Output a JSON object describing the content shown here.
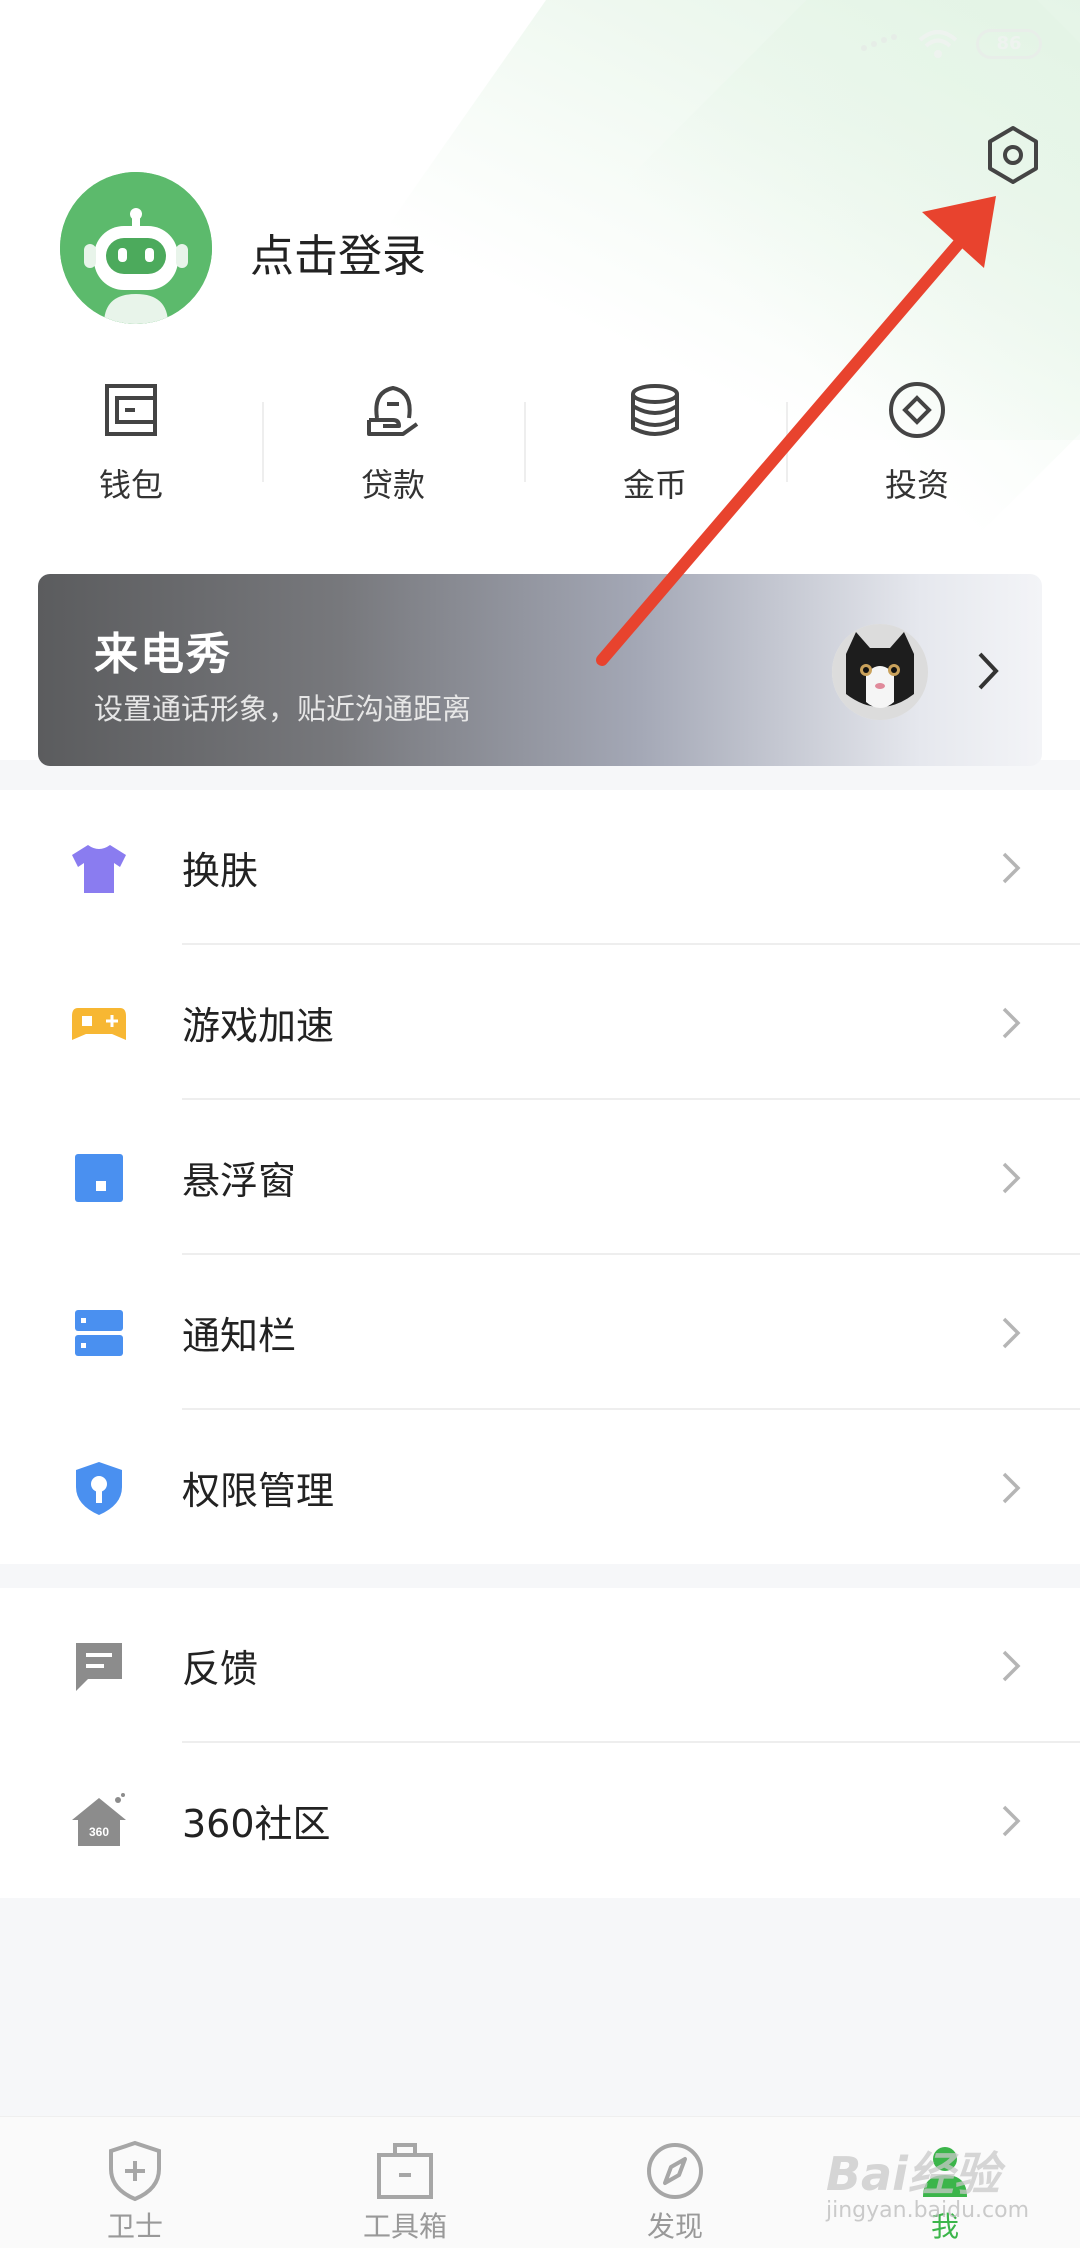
{
  "status_bar": {
    "battery": "86"
  },
  "profile": {
    "login_text": "点击登录"
  },
  "quick_actions": [
    {
      "label": "钱包",
      "icon": "wallet-icon"
    },
    {
      "label": "贷款",
      "icon": "loan-icon"
    },
    {
      "label": "金币",
      "icon": "coins-icon"
    },
    {
      "label": "投资",
      "icon": "invest-icon"
    }
  ],
  "banner": {
    "title": "来电秀",
    "subtitle": "设置通话形象，贴近沟通距离"
  },
  "menu_group1": [
    {
      "label": "换肤",
      "icon": "tshirt-icon",
      "color": "#8a7cf0"
    },
    {
      "label": "游戏加速",
      "icon": "gamepad-icon",
      "color": "#f7b733"
    },
    {
      "label": "悬浮窗",
      "icon": "floating-window-icon",
      "color": "#4a90f0"
    },
    {
      "label": "通知栏",
      "icon": "notification-bar-icon",
      "color": "#4a90f0"
    },
    {
      "label": "权限管理",
      "icon": "shield-key-icon",
      "color": "#4a90f0"
    }
  ],
  "menu_group2": [
    {
      "label": "反馈",
      "icon": "feedback-icon",
      "color": "#8c8c8c"
    },
    {
      "label": "360社区",
      "icon": "community-house-icon",
      "color": "#8c8c8c",
      "badge_text": "360"
    }
  ],
  "bottom_nav": [
    {
      "label": "卫士",
      "icon": "guard-shield-icon"
    },
    {
      "label": "工具箱",
      "icon": "toolbox-icon"
    },
    {
      "label": "发现",
      "icon": "compass-icon"
    },
    {
      "label": "我",
      "icon": "me-icon",
      "active": true
    }
  ],
  "watermark": {
    "text": "Bai经验",
    "sub": "jingyan.baidu.com"
  },
  "colors": {
    "accent_green": "#3bb54a",
    "annotation_red": "#e8432e"
  }
}
